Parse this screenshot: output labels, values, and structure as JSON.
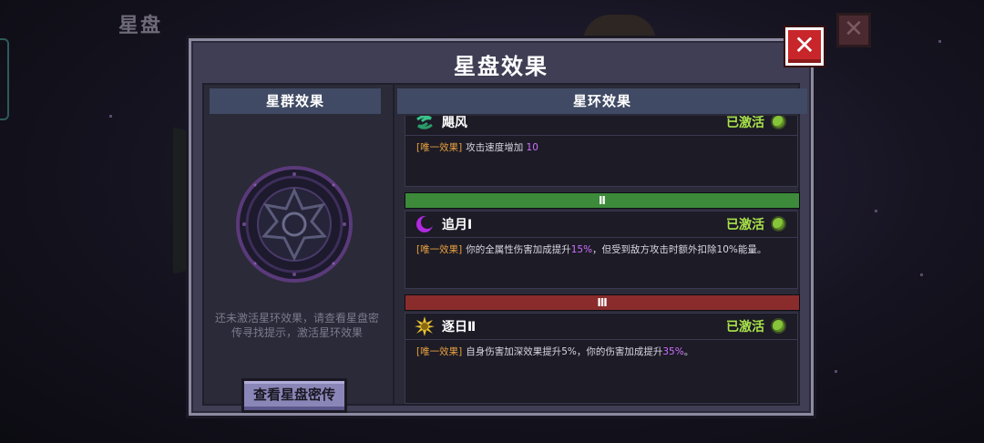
{
  "background": {
    "title": "星盘"
  },
  "panel": {
    "title": "星盘效果",
    "close_icon": "✕"
  },
  "left": {
    "header": "星群效果",
    "hint": "还未激活星环效果，请查看星盘密传寻找提示，激活星环效果",
    "button_label": "查看星盘密传"
  },
  "right": {
    "header": "星环效果",
    "effects": [
      {
        "icon": "swirl-wind-icon",
        "name": "飓风",
        "status": "已激活",
        "tag": "[唯一效果]",
        "desc_pre": "攻击速度增加 ",
        "desc_hl": "10",
        "desc_post": ""
      },
      {
        "icon": "crescent-moon-icon",
        "name": "追月Ⅰ",
        "status": "已激活",
        "tag": "[唯一效果]",
        "desc_pre": "你的全属性伤害加成提升",
        "desc_hl": "15%",
        "desc_post": "，但受到敌方攻击时额外扣除10%能量。"
      },
      {
        "icon": "sun-icon",
        "name": "逐日Ⅱ",
        "status": "已激活",
        "tag": "[唯一效果]",
        "desc_pre": "自身伤害加深效果提升5%，你的伤害加成提升",
        "desc_hl": "35%",
        "desc_post": "。"
      }
    ],
    "tiers": [
      "Ⅱ",
      "Ⅲ"
    ]
  },
  "colors": {
    "active_status": "#a8e24a",
    "highlight": "#d070ff",
    "tag": "#e8a040",
    "tier_2": "#3c8a3a",
    "tier_3": "#8a2c2c",
    "close_button": "#c8262a"
  }
}
